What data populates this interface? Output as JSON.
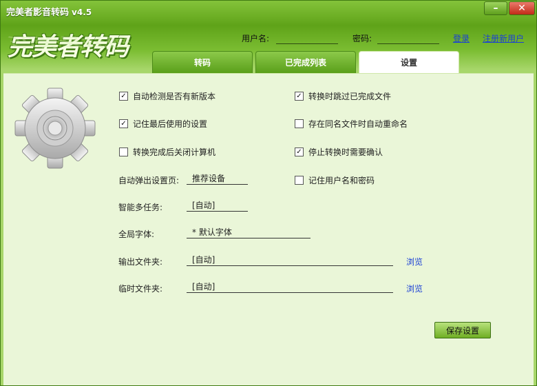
{
  "window": {
    "title": "完美者影音转码",
    "version": "v4.5",
    "minimize": "–",
    "close": "✕"
  },
  "logo": "完美者转码",
  "login": {
    "username_label": "用户名:",
    "password_label": "密码:",
    "login_link": "登录",
    "register_link": "注册新用户"
  },
  "tabs": [
    {
      "label": "转码"
    },
    {
      "label": "已完成列表"
    },
    {
      "label": "设置"
    }
  ],
  "settings": {
    "checkboxes": [
      {
        "label": "自动检测是否有新版本",
        "checked": true
      },
      {
        "label": "转换时跳过已完成文件",
        "checked": true
      },
      {
        "label": "记住最后使用的设置",
        "checked": true
      },
      {
        "label": "存在同名文件时自动重命名",
        "checked": false
      },
      {
        "label": "转换完成后关闭计算机",
        "checked": false
      },
      {
        "label": "停止转换时需要确认",
        "checked": true
      },
      {
        "label": "记住用户名和密码",
        "checked": false
      }
    ],
    "popup_label": "自动弹出设置页:",
    "popup_value": "推荐设备",
    "multitask_label": "智能多任务:",
    "multitask_value": "[自动]",
    "font_label": "全局字体:",
    "font_value": "* 默认字体",
    "output_label": "输出文件夹:",
    "output_value": "[自动]",
    "temp_label": "临时文件夹:",
    "temp_value": "[自动]",
    "browse": "浏览",
    "save_button": "保存设置"
  }
}
